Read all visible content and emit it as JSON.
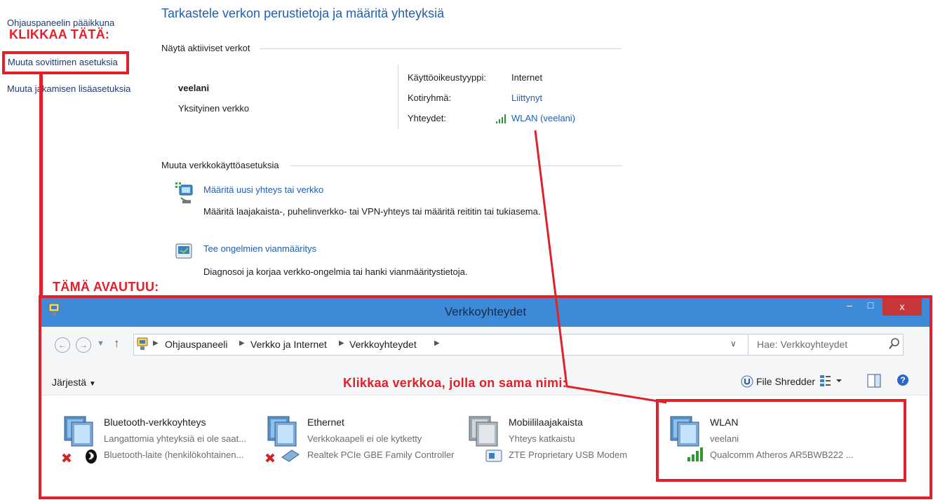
{
  "left_nav": {
    "home": "Ohjauspaneelin pääikkuna",
    "change_adapter": "Muuta sovittimen asetuksia",
    "change_sharing": "Muuta jakamisen lisäasetuksia"
  },
  "annotations": {
    "click_this": "KLIKKAA TÄTÄ:",
    "this_opens": "TÄMÄ AVAUTUU:",
    "click_network": "Klikkaa verkkoa, jolla on sama nimi:"
  },
  "main": {
    "title": "Tarkastele verkon perustietoja ja määritä yhteyksiä",
    "active_networks_heading": "Näytä aktiiviset verkot",
    "network_name": "veelani",
    "network_type": "Yksityinen verkko",
    "props": [
      {
        "label": "Käyttöoikeustyyppi:",
        "value": "Internet"
      },
      {
        "label": "Kotiryhmä:",
        "value": "Liittynyt"
      },
      {
        "label": "Yhteydet:",
        "value": "WLAN (veelani)"
      }
    ],
    "change_settings_heading": "Muuta verkkokäyttöasetuksia",
    "tasks": [
      {
        "title": "Määritä uusi yhteys tai verkko",
        "desc": "Määritä laajakaista-, puhelinverkko- tai VPN-yhteys tai määritä reititin tai tukiasema.",
        "icon": "new-connection-icon"
      },
      {
        "title": "Tee ongelmien vianmääritys",
        "desc": "Diagnosoi ja korjaa verkko-ongelmia tai hanki vianmääritystietoja.",
        "icon": "troubleshoot-icon"
      }
    ]
  },
  "window": {
    "title": "Verkkoyhteydet",
    "close": "x",
    "breadcrumb": [
      "Ohjauspaneeli",
      "Verkko ja Internet",
      "Verkkoyhteydet"
    ],
    "search_placeholder": "Hae: Verkkoyhteydet",
    "organize": "Järjestä",
    "file_shredder": "File Shredder",
    "adapters": [
      {
        "name": "Bluetooth-verkkoyhteys",
        "status": "Langattomia yhteyksiä ei ole saat...",
        "device": "Bluetooth-laite (henkilökohtainen...",
        "icon": "bluetooth-network-icon"
      },
      {
        "name": "Ethernet",
        "status": "Verkkokaapeli ei ole kytketty",
        "device": "Realtek PCIe GBE Family Controller",
        "icon": "ethernet-network-icon"
      },
      {
        "name": "Mobiililaajakaista",
        "status": "Yhteys katkaistu",
        "device": "ZTE Proprietary USB Modem",
        "icon": "mobile-broadband-icon"
      },
      {
        "name": "WLAN",
        "status": "veelani",
        "device": "Qualcomm Atheros AR5BWB222 ...",
        "icon": "wifi-network-icon"
      }
    ]
  },
  "colors": {
    "annotation_red": "#e0202a",
    "link_blue": "#1f5fb4",
    "titlebar_blue": "#3c8ad8",
    "close_red": "#c7373a"
  }
}
